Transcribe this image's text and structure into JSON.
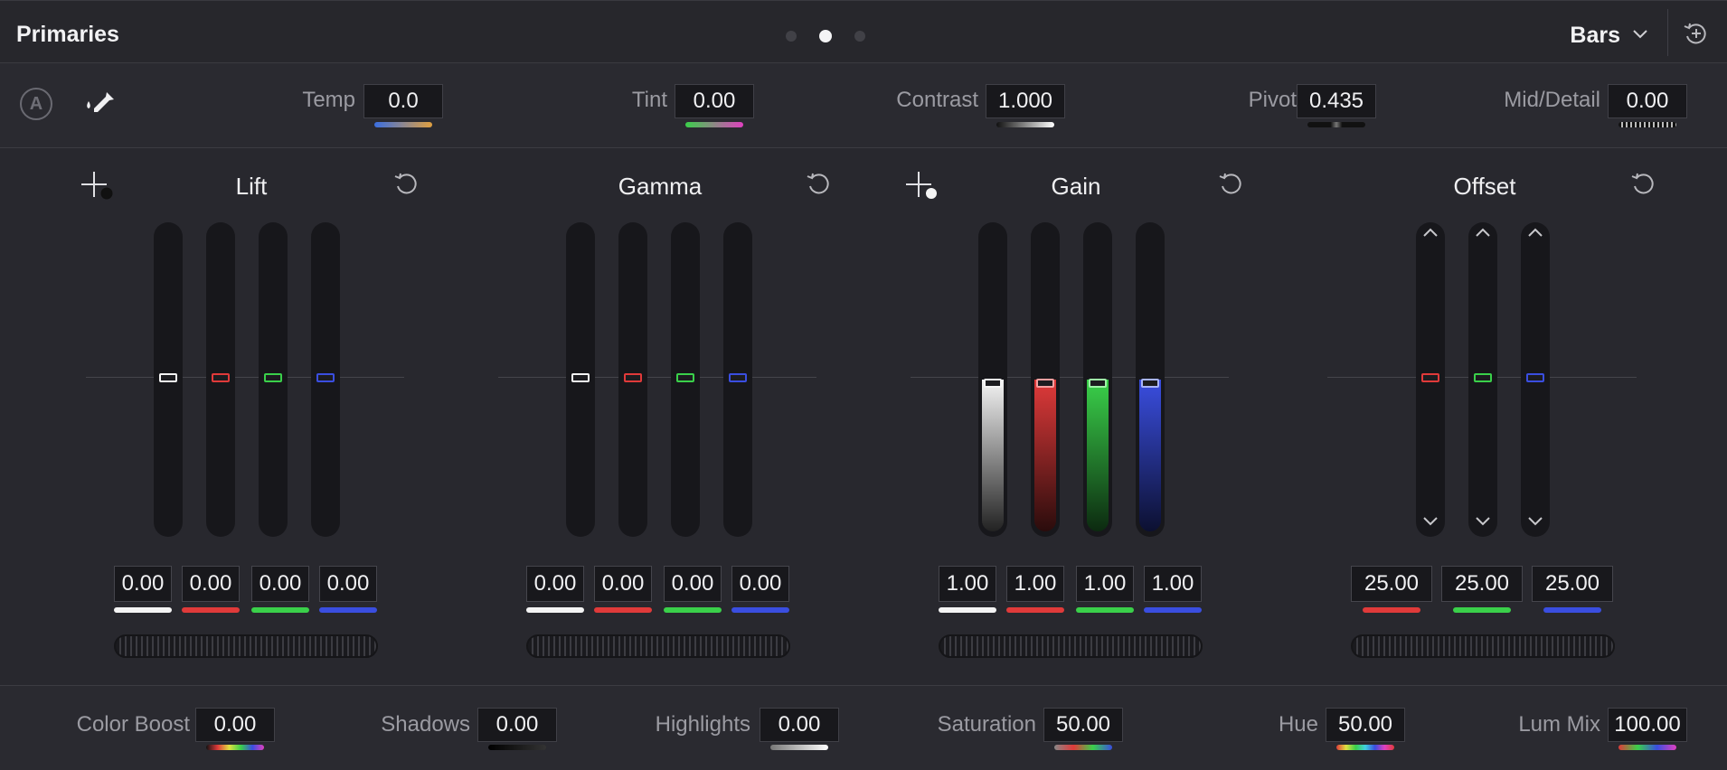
{
  "header": {
    "title": "Primaries",
    "mode_label": "Bars",
    "page_dots": 3,
    "active_page": 2
  },
  "adjustments": {
    "temp": {
      "label": "Temp",
      "value": "0.0"
    },
    "tint": {
      "label": "Tint",
      "value": "0.00"
    },
    "contrast": {
      "label": "Contrast",
      "value": "1.000"
    },
    "pivot": {
      "label": "Pivot",
      "value": "0.435"
    },
    "mid_detail": {
      "label": "Mid/Detail",
      "value": "0.00"
    },
    "auto_label": "A"
  },
  "panels": {
    "lift": {
      "title": "Lift",
      "values": [
        "0.00",
        "0.00",
        "0.00",
        "0.00"
      ]
    },
    "gamma": {
      "title": "Gamma",
      "values": [
        "0.00",
        "0.00",
        "0.00",
        "0.00"
      ]
    },
    "gain": {
      "title": "Gain",
      "values": [
        "1.00",
        "1.00",
        "1.00",
        "1.00"
      ]
    },
    "offset": {
      "title": "Offset",
      "values": [
        "25.00",
        "25.00",
        "25.00"
      ]
    }
  },
  "bottom": {
    "color_boost": {
      "label": "Color Boost",
      "value": "0.00"
    },
    "shadows": {
      "label": "Shadows",
      "value": "0.00"
    },
    "highlights": {
      "label": "Highlights",
      "value": "0.00"
    },
    "saturation": {
      "label": "Saturation",
      "value": "50.00"
    },
    "hue": {
      "label": "Hue",
      "value": "50.00"
    },
    "lum_mix": {
      "label": "Lum Mix",
      "value": "100.00"
    }
  },
  "colors": {
    "white": "#f4f4f4",
    "red": "#e03a3a",
    "green": "#3ad04a",
    "blue": "#3a4ee0",
    "background": "#28282e"
  },
  "icons": [
    "auto-balance-icon",
    "eyedropper-icon",
    "crosshair-picker-icon",
    "reset-icon",
    "chevron-down-icon",
    "history-reset-icon",
    "chevron-up-icon"
  ]
}
